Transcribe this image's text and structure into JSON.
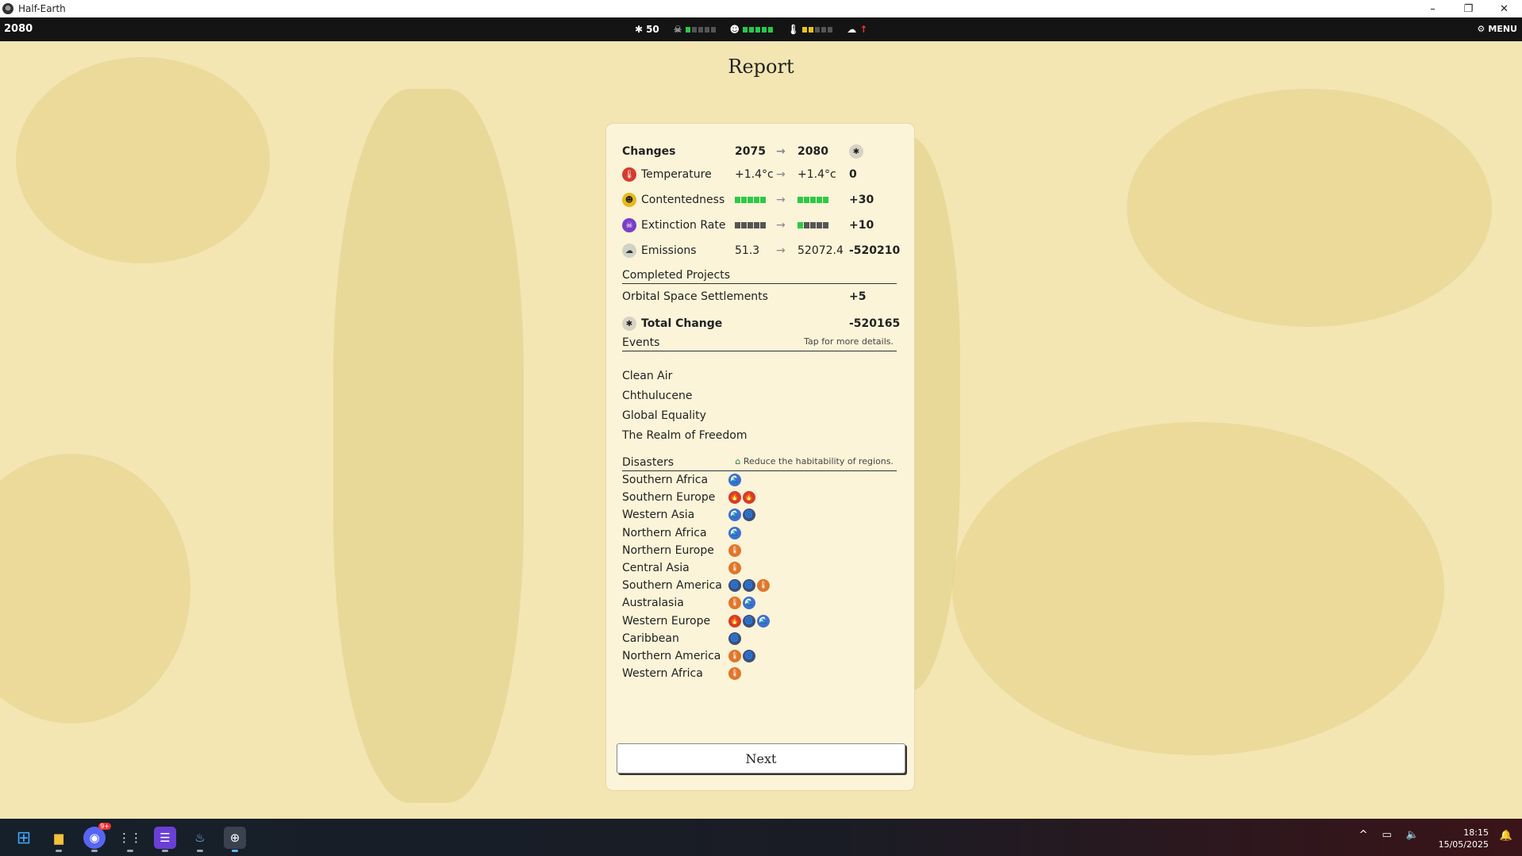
{
  "window": {
    "title": "Half-Earth",
    "minimize": "–",
    "restore": "❐",
    "close": "✕"
  },
  "topbar": {
    "year": "2080",
    "pc": "50",
    "menu": "MENU",
    "extinction_level": 1,
    "contentedness_level": 5,
    "temperature_level": 2,
    "emissions_trend": "↑"
  },
  "report": {
    "title": "Report",
    "changes": {
      "heading": "Changes",
      "from_year": "2075",
      "to_year": "2080",
      "rows": [
        {
          "name": "Temperature",
          "from": "+1.4°c",
          "to": "+1.4°c",
          "delta": "0",
          "icon": "thermometer-icon"
        },
        {
          "name": "Contentedness",
          "from_level": 5,
          "to_level": 5,
          "delta": "+30",
          "icon": "smile-icon"
        },
        {
          "name": "Extinction Rate",
          "from_level": 0,
          "to_level": 1,
          "delta": "+10",
          "icon": "skull-icon"
        },
        {
          "name": "Emissions",
          "from": "51.3",
          "to": "52072.4",
          "delta": "-520210",
          "icon": "cloud-icon"
        }
      ]
    },
    "completed_projects": {
      "heading": "Completed Projects",
      "items": [
        {
          "name": "Orbital Space Settlements",
          "delta": "+5"
        }
      ]
    },
    "total_change": {
      "label": "Total Change",
      "value": "-520165"
    },
    "events": {
      "heading": "Events",
      "note": "Tap for more details.",
      "items": [
        "Clean Air",
        "Chthulucene",
        "Global Equality",
        "The Realm of Freedom"
      ]
    },
    "disasters": {
      "heading": "Disasters",
      "note": "Reduce the habitability of regions.",
      "regions": [
        {
          "name": "Southern Africa",
          "icons": [
            "flood"
          ]
        },
        {
          "name": "Southern Europe",
          "icons": [
            "fire",
            "fire"
          ]
        },
        {
          "name": "Western Asia",
          "icons": [
            "flood",
            "storm"
          ]
        },
        {
          "name": "Northern Africa",
          "icons": [
            "flood"
          ]
        },
        {
          "name": "Northern Europe",
          "icons": [
            "heat"
          ]
        },
        {
          "name": "Central Asia",
          "icons": [
            "heat"
          ]
        },
        {
          "name": "Southern America",
          "icons": [
            "storm",
            "storm",
            "heat"
          ]
        },
        {
          "name": "Australasia",
          "icons": [
            "heat",
            "flood"
          ]
        },
        {
          "name": "Western Europe",
          "icons": [
            "fire",
            "storm",
            "flood"
          ]
        },
        {
          "name": "Caribbean",
          "icons": [
            "storm"
          ]
        },
        {
          "name": "Northern America",
          "icons": [
            "heat",
            "storm"
          ]
        },
        {
          "name": "Western Africa",
          "icons": [
            "heat"
          ]
        }
      ]
    },
    "next_label": "Next"
  },
  "taskbar": {
    "time": "18:15",
    "date": "15/05/2025",
    "discord_badge": "9+"
  }
}
